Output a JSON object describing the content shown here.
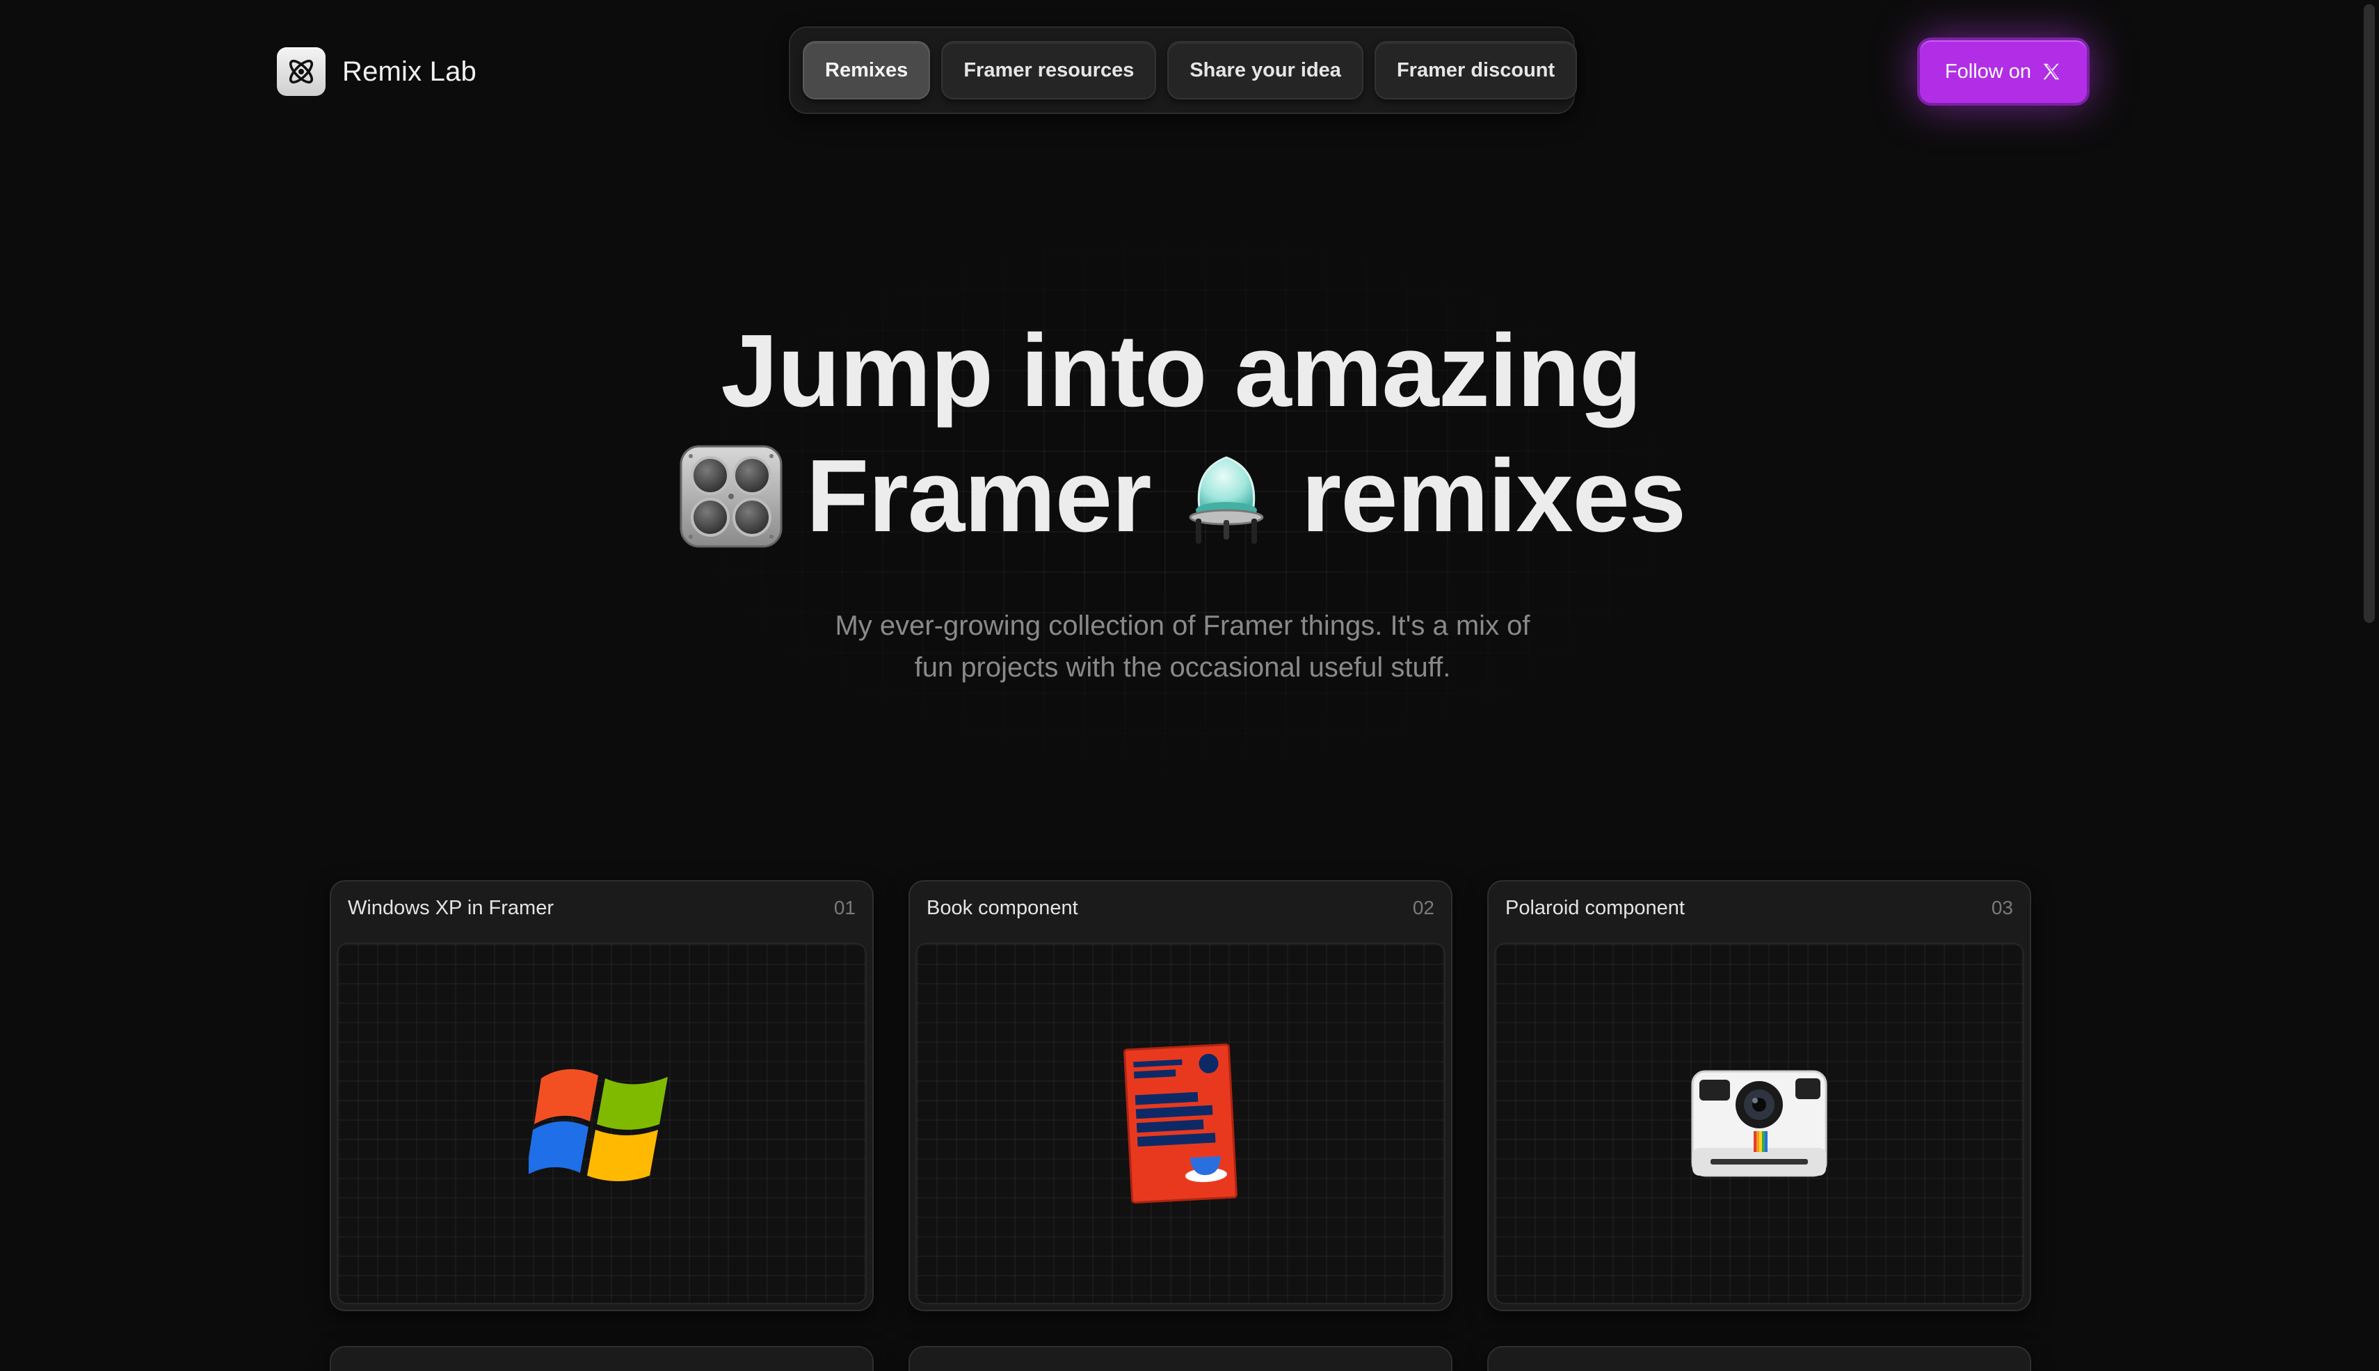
{
  "brand": {
    "name": "Remix Lab",
    "logo_icon": "atom-icon"
  },
  "nav": {
    "items": [
      {
        "label": "Remixes",
        "active": true
      },
      {
        "label": "Framer resources",
        "active": false
      },
      {
        "label": "Share your idea",
        "active": false
      },
      {
        "label": "Framer discount",
        "active": false
      }
    ]
  },
  "follow": {
    "label": "Follow on",
    "icon": "x-logo-icon",
    "color": "#b22ee6"
  },
  "hero": {
    "line1": "Jump into amazing",
    "line2_word1": "Framer",
    "line2_word2": "remixes",
    "icon_left": "dice-button-icon",
    "icon_right": "flask-icon",
    "subtitle_line1": "My ever-growing collection of Framer things. It's a mix of",
    "subtitle_line2": "fun projects with the occasional useful stuff."
  },
  "cards": [
    {
      "title": "Windows XP in Framer",
      "number": "01",
      "icon": "windows-logo-icon"
    },
    {
      "title": "Book component",
      "number": "02",
      "icon": "book-icon"
    },
    {
      "title": "Polaroid component",
      "number": "03",
      "icon": "polaroid-camera-icon"
    }
  ],
  "colors": {
    "background": "#0c0c0c",
    "accent": "#b22ee6",
    "card": "#1b1b1b"
  }
}
